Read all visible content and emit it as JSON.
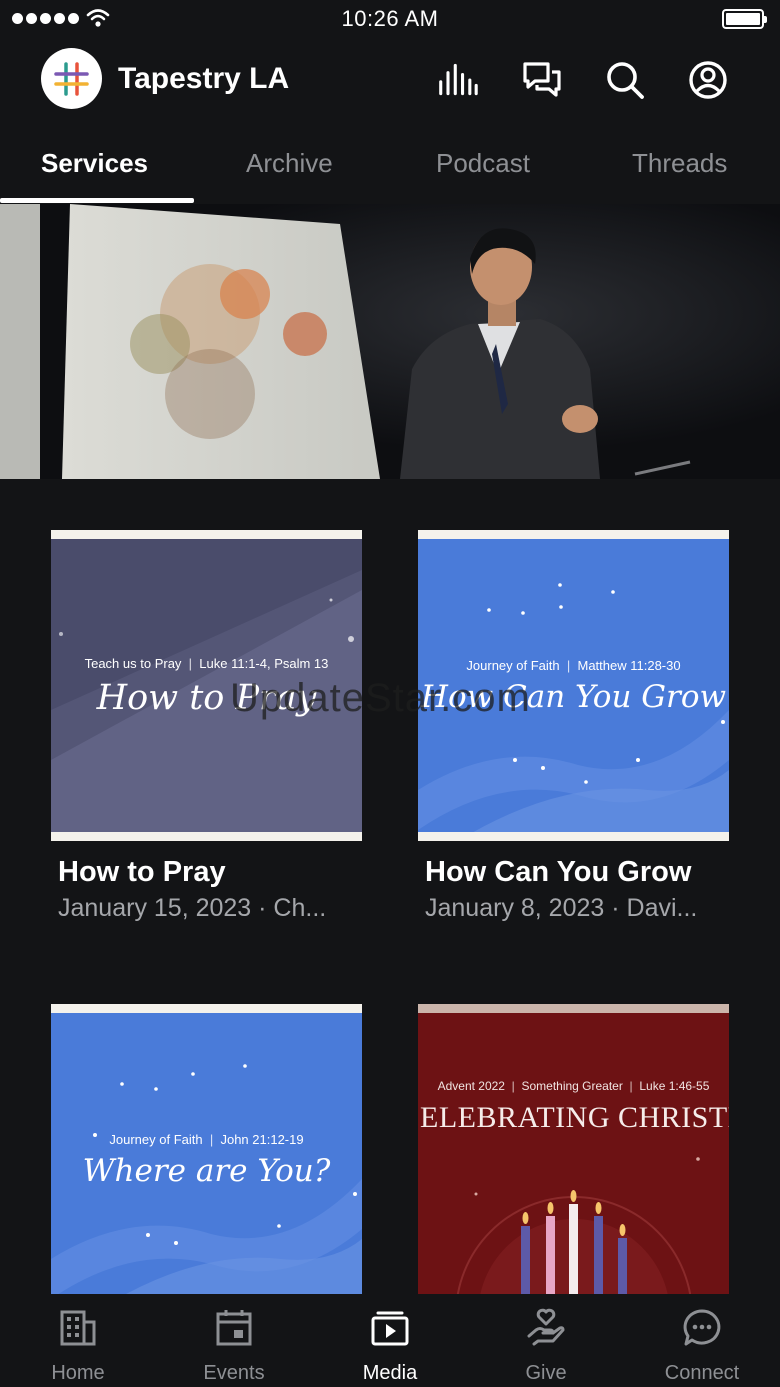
{
  "status_bar": {
    "time": "10:26 AM",
    "signal_icon": "signal-dots-icon",
    "wifi_icon": "wifi-icon",
    "battery_icon": "battery-icon",
    "battery_level": 1.0
  },
  "header": {
    "app_name": "Tapestry LA",
    "logo_icon": "hash-logo-icon",
    "actions": [
      {
        "icon": "audio-bars-icon"
      },
      {
        "icon": "chat-bubbles-icon"
      },
      {
        "icon": "search-icon"
      },
      {
        "icon": "account-icon"
      }
    ]
  },
  "tabs": [
    {
      "label": "Services",
      "active": true
    },
    {
      "label": "Archive",
      "active": false
    },
    {
      "label": "Podcast",
      "active": false
    },
    {
      "label": "Threads",
      "active": false
    }
  ],
  "cards": [
    {
      "title": "How to Pray",
      "subtitle": "January 15, 2023 · Ch...",
      "art_series": "Teach us to Pray",
      "art_passage": "Luke 11:1-4, Psalm 13",
      "art_title": "How to Pray"
    },
    {
      "title": "How Can You Grow",
      "subtitle": "January 8, 2023 · Davi...",
      "art_series": "Journey of Faith",
      "art_passage": "Matthew 11:28-30",
      "art_title": "How Can You Grow"
    },
    {
      "art_series": "Journey of Faith",
      "art_passage": "John 21:12-19",
      "art_title": "Where are You?"
    },
    {
      "art_series": "Advent 2022",
      "art_theme": "Something Greater",
      "art_passage": "Luke 1:46-55",
      "art_title": "ELEBRATING CHRISTMA"
    }
  ],
  "watermark": "UpdateStar.com",
  "bottom_nav": [
    {
      "label": "Home",
      "icon": "building-icon",
      "active": false
    },
    {
      "label": "Events",
      "icon": "calendar-icon",
      "active": false
    },
    {
      "label": "Media",
      "icon": "media-play-icon",
      "active": true
    },
    {
      "label": "Give",
      "icon": "hand-heart-icon",
      "active": false
    },
    {
      "label": "Connect",
      "icon": "chat-dots-icon",
      "active": false
    }
  ],
  "colors": {
    "background": "#131416",
    "text_primary": "#ffffff",
    "text_secondary": "#a5a7ab",
    "tab_inactive": "#8e9094",
    "art_gray_blue": "#545676",
    "art_blue": "#4a7bd9",
    "art_maroon": "#6d1214"
  }
}
